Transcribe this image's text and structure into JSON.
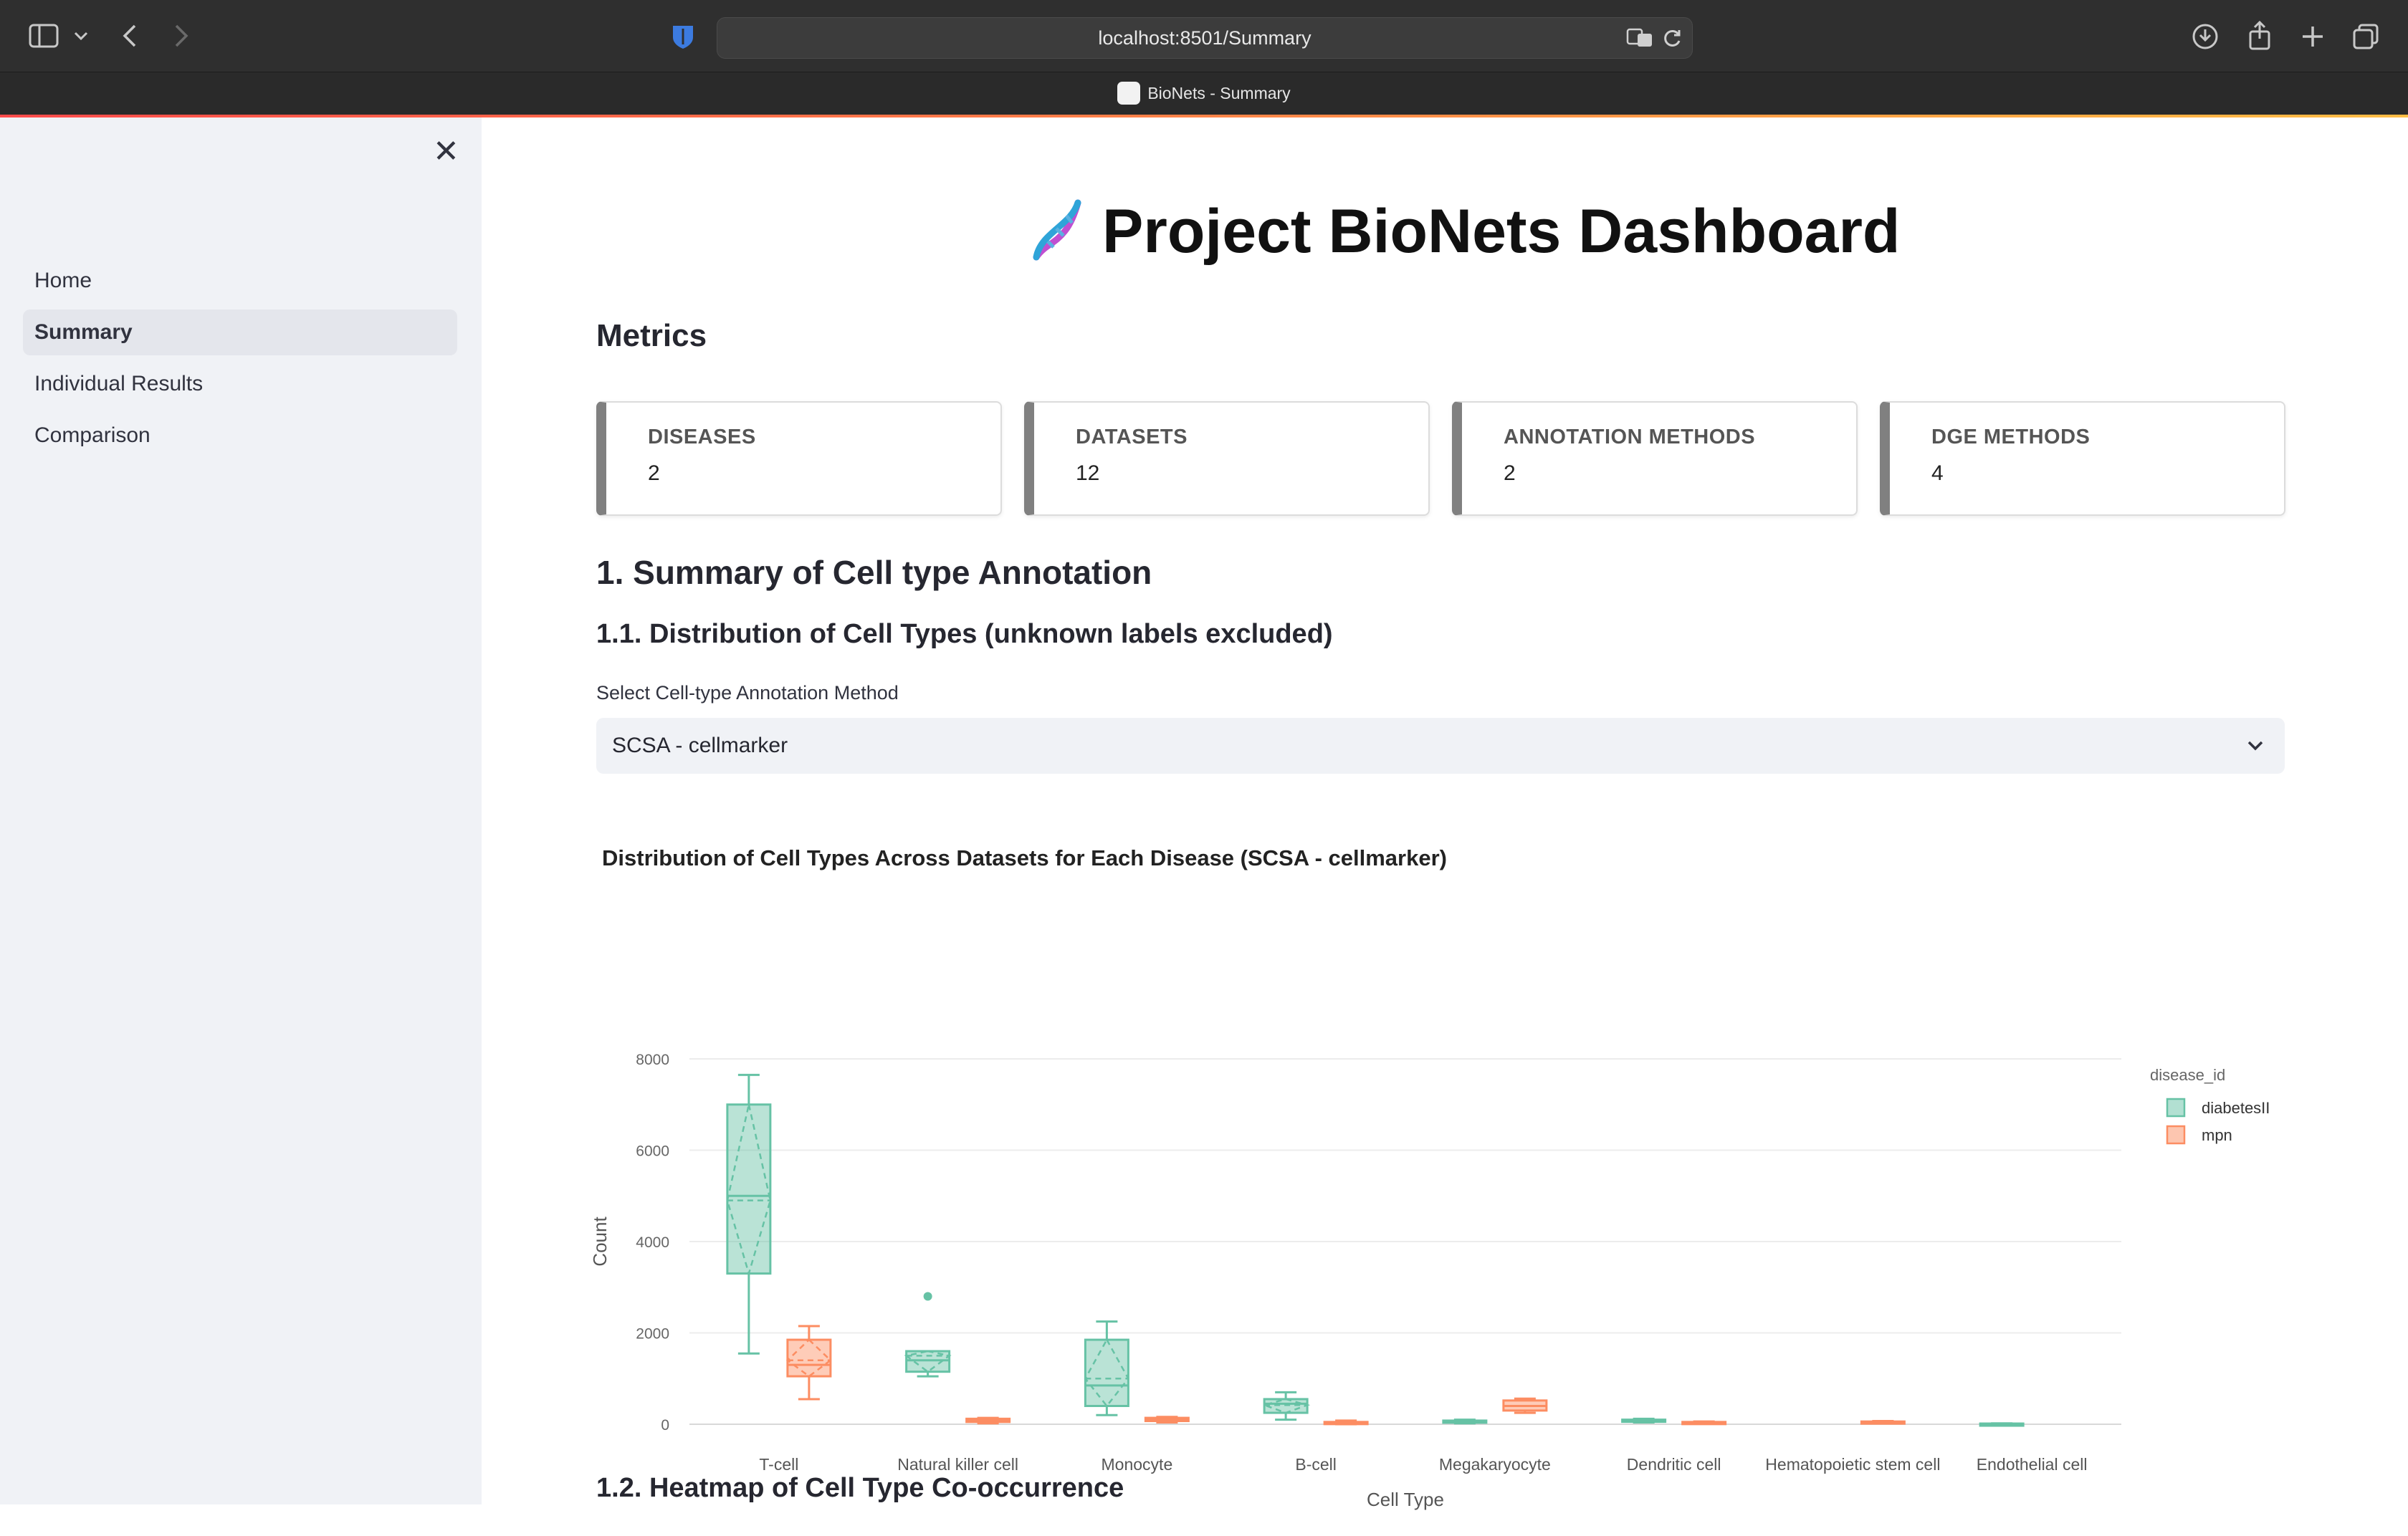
{
  "browser": {
    "url": "localhost:8501/Summary",
    "tab_title": "BioNets - Summary"
  },
  "sidebar": {
    "items": [
      {
        "label": "Home",
        "active": false
      },
      {
        "label": "Summary",
        "active": true
      },
      {
        "label": "Individual Results",
        "active": false
      },
      {
        "label": "Comparison",
        "active": false
      }
    ]
  },
  "page": {
    "title": "Project BioNets Dashboard",
    "metrics_heading": "Metrics",
    "metrics": [
      {
        "label": "DISEASES",
        "value": "2"
      },
      {
        "label": "DATASETS",
        "value": "12"
      },
      {
        "label": "ANNOTATION METHODS",
        "value": "2"
      },
      {
        "label": "DGE METHODS",
        "value": "4"
      }
    ],
    "section1_heading": "1. Summary of Cell type Annotation",
    "section11_heading": "1.1. Distribution of Cell Types (unknown labels excluded)",
    "select_label": "Select Cell-type Annotation Method",
    "select_value": "SCSA - cellmarker",
    "section12_heading": "1.2. Heatmap of Cell Type Co-occurrence"
  },
  "chart_data": {
    "type": "box",
    "title": "Distribution of Cell Types Across Datasets for Each Disease (SCSA - cellmarker)",
    "xlabel": "Cell Type",
    "ylabel": "Count",
    "ylim": [
      0,
      8000
    ],
    "yticks": [
      0,
      2000,
      4000,
      6000,
      8000
    ],
    "legend_title": "disease_id",
    "legend_position": "top-right",
    "grid": true,
    "categories": [
      "T-cell",
      "Natural killer cell",
      "Monocyte",
      "B-cell",
      "Megakaryocyte",
      "Dendritic cell",
      "Hematopoietic stem cell",
      "Endothelial cell"
    ],
    "series": [
      {
        "name": "diabetesII",
        "color": "#66c2a5",
        "boxes": [
          {
            "category": "T-cell",
            "min": 1550,
            "q1": 3300,
            "median": 5000,
            "q3": 7000,
            "max": 7650,
            "mean": 4900
          },
          {
            "category": "Natural killer cell",
            "min": 1050,
            "q1": 1150,
            "median": 1400,
            "q3": 1600,
            "max": 1600,
            "mean": 1500,
            "outliers": [
              2800
            ]
          },
          {
            "category": "Monocyte",
            "min": 200,
            "q1": 400,
            "median": 850,
            "q3": 1850,
            "max": 2250,
            "mean": 1000
          },
          {
            "category": "B-cell",
            "min": 100,
            "q1": 250,
            "median": 450,
            "q3": 550,
            "max": 700,
            "mean": 420
          },
          {
            "category": "Megakaryocyte",
            "min": 20,
            "q1": 40,
            "median": 60,
            "q3": 80,
            "max": 100
          },
          {
            "category": "Dendritic cell",
            "min": 40,
            "q1": 60,
            "median": 80,
            "q3": 100,
            "max": 120
          }
        ]
      },
      {
        "name": "mpn",
        "color": "#fc8d62",
        "boxes": [
          {
            "category": "T-cell",
            "min": 550,
            "q1": 1050,
            "median": 1300,
            "q3": 1850,
            "max": 2150,
            "mean": 1400
          },
          {
            "category": "Natural killer cell",
            "min": 20,
            "q1": 50,
            "median": 80,
            "q3": 120,
            "max": 140
          },
          {
            "category": "Monocyte",
            "min": 40,
            "q1": 70,
            "median": 100,
            "q3": 140,
            "max": 160
          },
          {
            "category": "B-cell",
            "min": 0,
            "q1": 10,
            "median": 30,
            "q3": 50,
            "max": 80
          },
          {
            "category": "Megakaryocyte",
            "min": 250,
            "q1": 300,
            "median": 400,
            "q3": 520,
            "max": 560
          },
          {
            "category": "Dendritic cell",
            "min": 20,
            "q1": 30,
            "median": 40,
            "q3": 50,
            "max": 60
          },
          {
            "category": "Hematopoietic stem cell",
            "min": 30,
            "q1": 40,
            "median": 50,
            "q3": 60,
            "max": 70
          }
        ]
      }
    ],
    "extra": [
      {
        "series": "diabetesII",
        "category": "Endothelial cell",
        "min": 0,
        "q1": 5,
        "median": 10,
        "q3": 15,
        "max": 20
      }
    ]
  }
}
